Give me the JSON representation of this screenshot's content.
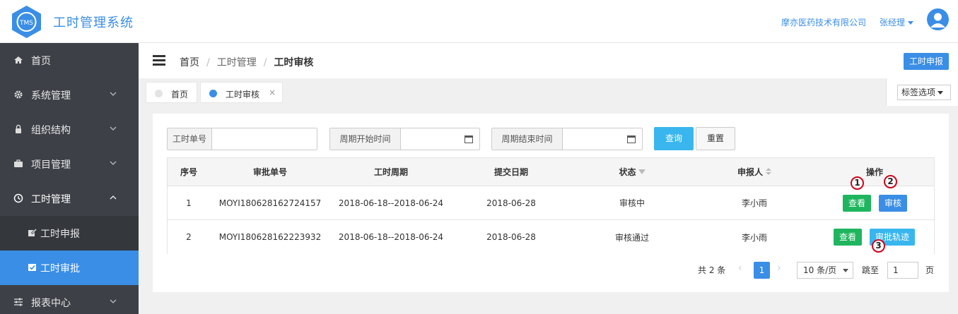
{
  "app": {
    "title": "工时管理系统",
    "logo_text": "TMS"
  },
  "header": {
    "company": "摩亦医药技术有限公司",
    "user": "张经理"
  },
  "sidebar": {
    "items": [
      {
        "label": "首页",
        "icon": "home-icon"
      },
      {
        "label": "系统管理",
        "icon": "gear-icon"
      },
      {
        "label": "组织结构",
        "icon": "lock-icon"
      },
      {
        "label": "项目管理",
        "icon": "briefcase-icon"
      },
      {
        "label": "工时管理",
        "icon": "clock-icon"
      },
      {
        "label": "工时申报",
        "icon": "edit-icon"
      },
      {
        "label": "工时审批",
        "icon": "checkbox-icon"
      },
      {
        "label": "报表中心",
        "icon": "sliders-icon"
      }
    ]
  },
  "breadcrumb": {
    "home": "首页",
    "section": "工时管理",
    "current": "工时审核",
    "separator": "/"
  },
  "toolbar": {
    "report_button": "工时申报"
  },
  "tabs": [
    {
      "label": "首页"
    },
    {
      "label": "工时审核",
      "close": "×"
    }
  ],
  "tab_options": {
    "label": "标签选项"
  },
  "search": {
    "order_no_label": "工时单号",
    "order_no_value": "",
    "start_label": "周期开始时间",
    "start_value": "",
    "end_label": "周期结束时间",
    "end_value": "",
    "query_button": "查询",
    "reset_button": "重置"
  },
  "table": {
    "headers": {
      "index": "序号",
      "order_no": "审批单号",
      "period": "工时周期",
      "date": "提交日期",
      "status": "状态",
      "person": "申报人",
      "actions": "操作"
    },
    "rows": [
      {
        "index": "1",
        "order_no": "MOYI180628162724157",
        "period": "2018-06-18--2018-06-24",
        "date": "2018-06-28",
        "status": "审核中",
        "person": "李小雨",
        "btn1": "查看",
        "btn2": "审核"
      },
      {
        "index": "2",
        "order_no": "MOYI180628162223932",
        "period": "2018-06-18--2018-06-24",
        "date": "2018-06-28",
        "status": "审核通过",
        "person": "李小雨",
        "btn1": "查看",
        "btn2": "审批轨迹"
      }
    ]
  },
  "markers": [
    "1",
    "2",
    "3"
  ],
  "pagination": {
    "total": "共 2 条",
    "prev": "‹",
    "current": "1",
    "next": "›",
    "page_size": "10 条/页",
    "jump_label": "跳至",
    "jump_value": "1",
    "page_suffix": "页"
  },
  "colors": {
    "primary": "#3a8ee6",
    "sidebar": "#3d4147",
    "success": "#1fb55e",
    "info": "#3ab6ee",
    "marker": "#d0021b"
  }
}
